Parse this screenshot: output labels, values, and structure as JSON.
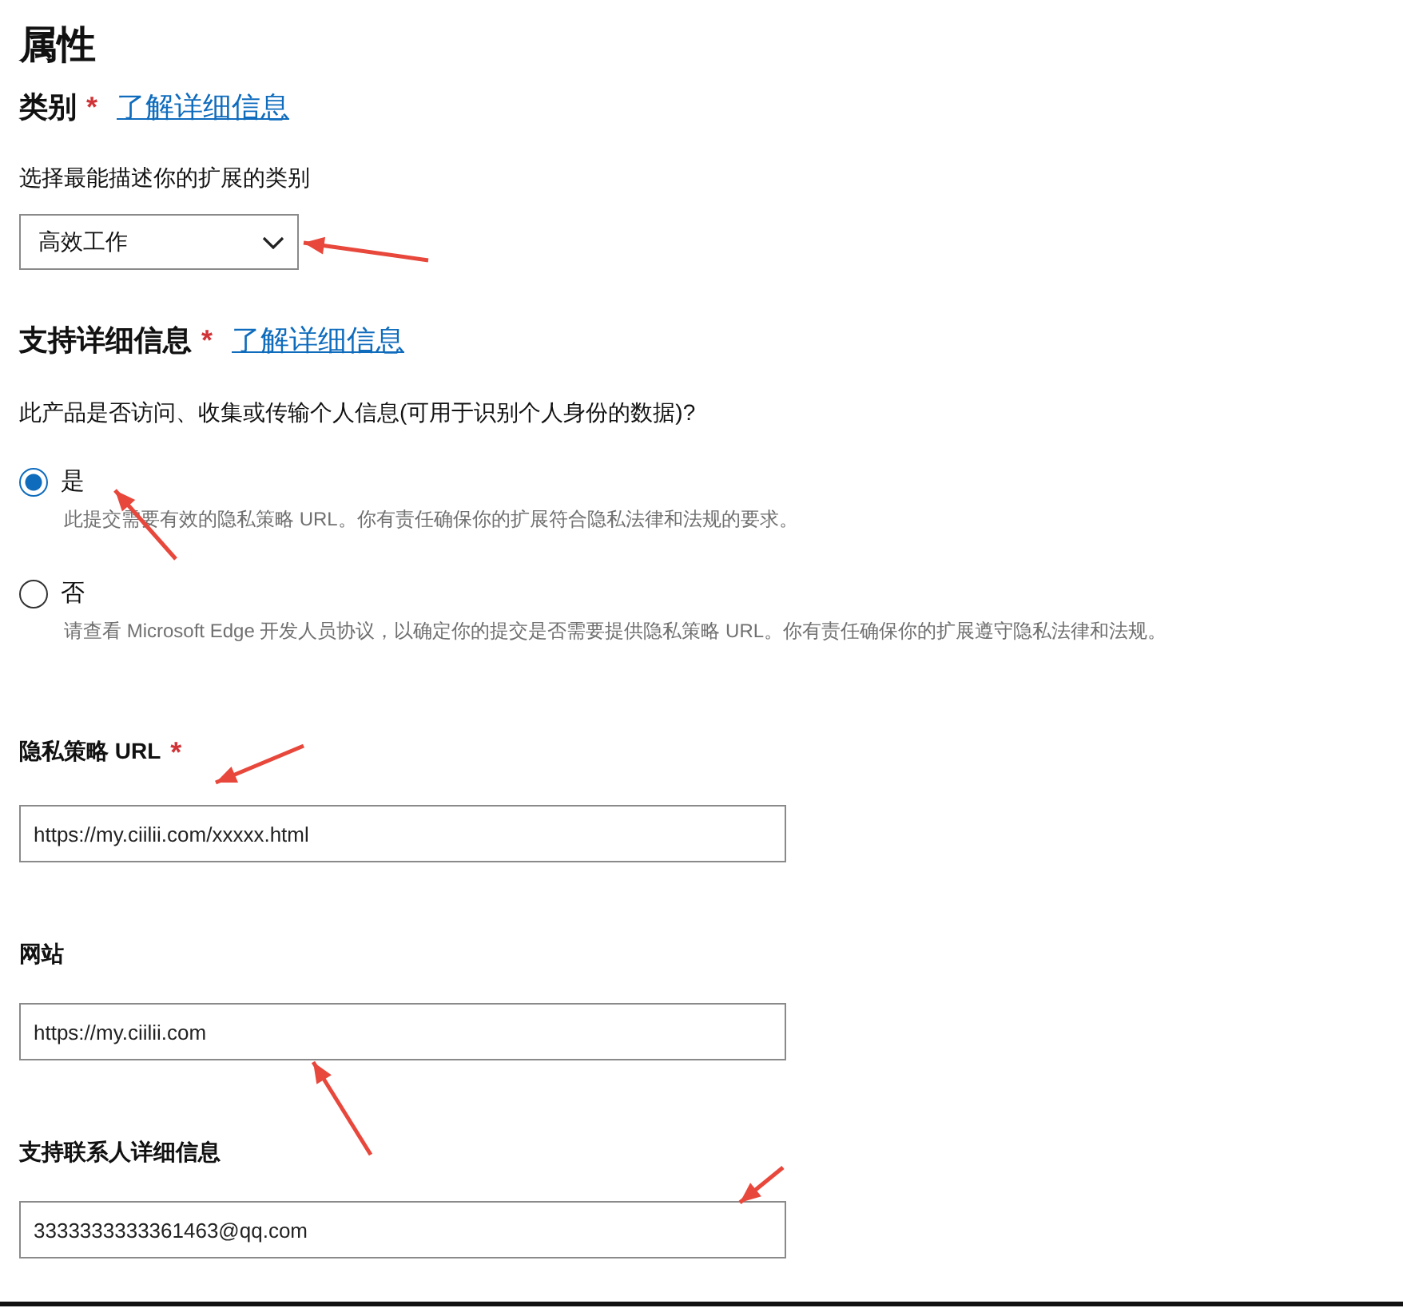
{
  "page_title": "属性",
  "category": {
    "title": "类别",
    "required_mark": "*",
    "link": "了解详细信息",
    "description": "选择最能描述你的扩展的类别",
    "dropdown": {
      "value": "高效工作"
    }
  },
  "support": {
    "title": "支持详细信息",
    "required_mark": "*",
    "link": "了解详细信息",
    "question": "此产品是否访问、收集或传输个人信息(可用于识别个人身份的数据)?",
    "options": [
      {
        "label": "是",
        "description": "此提交需要有效的隐私策略 URL。你有责任确保你的扩展符合隐私法律和法规的要求。",
        "selected": true
      },
      {
        "label": "否",
        "description": "请查看 Microsoft Edge 开发人员协议，以确定你的提交是否需要提供隐私策略 URL。你有责任确保你的扩展遵守隐私法律和法规。",
        "selected": false
      }
    ]
  },
  "fields": [
    {
      "label": "隐私策略 URL",
      "required_mark": "*",
      "value": "https://my.ciilii.com/xxxxx.html"
    },
    {
      "label": "网站",
      "value": "https://my.ciilii.com"
    },
    {
      "label": "支持联系人详细信息",
      "value": "3333333333361463@qq.com"
    }
  ]
}
